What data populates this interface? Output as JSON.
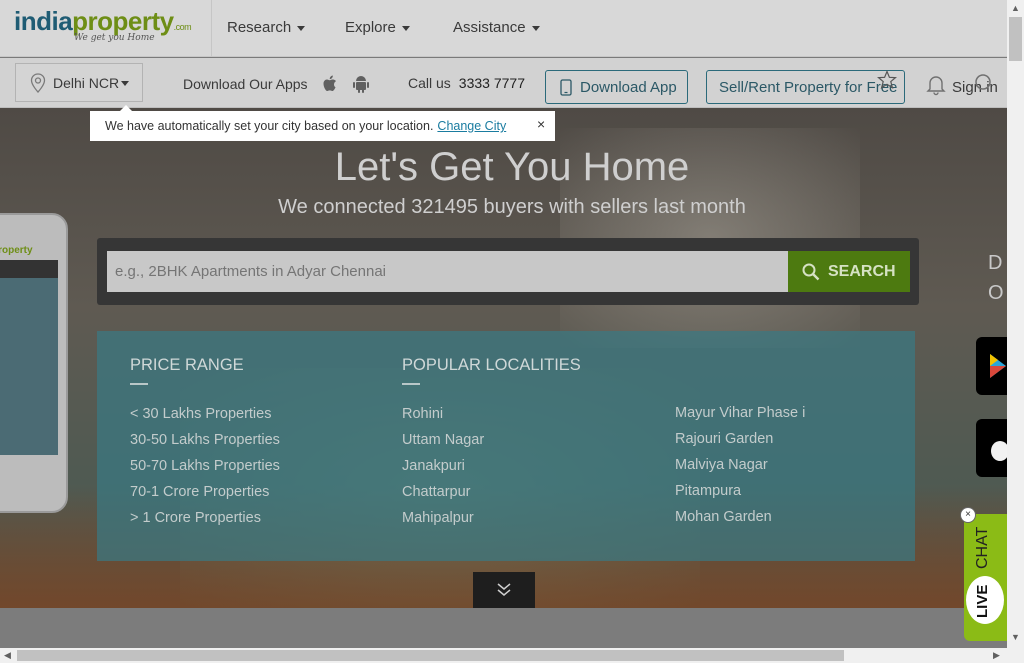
{
  "header": {
    "logo": {
      "part1": "india",
      "part2": "property",
      "suffix": ".com",
      "tagline": "We get you Home"
    },
    "nav": [
      {
        "label": "Research"
      },
      {
        "label": "Explore"
      },
      {
        "label": "Assistance"
      }
    ]
  },
  "subbar": {
    "city": "Delhi NCR",
    "apps_label": "Download Our Apps",
    "call_label": "Call us",
    "phone": "3333 7777",
    "download_app_label": "Download App",
    "sell_rent_label": "Sell/Rent Property for Free",
    "signin_label": "Sign in"
  },
  "city_tooltip": {
    "message": "We have automatically set your city based on your location.",
    "link": "Change City",
    "close": "×"
  },
  "hero": {
    "headline": "Let's Get You Home",
    "subline": "We connected 321495 buyers with sellers last month",
    "search_placeholder": "e.g., 2BHK Apartments in Adyar Chennai",
    "search_button": "SEARCH"
  },
  "quick_links": {
    "price_heading": "PRICE RANGE",
    "price_items": [
      "< 30 Lakhs Properties",
      "30-50 Lakhs Properties",
      "50-70 Lakhs Properties",
      "70-1 Crore Properties",
      "> 1 Crore Properties"
    ],
    "localities_heading": "POPULAR LOCALITIES",
    "localities_col1": [
      "Rohini",
      "Uttam Nagar",
      "Janakpuri",
      "Chattarpur",
      "Mahipalpur"
    ],
    "localities_col2": [
      "Mayur Vihar Phase i",
      "Rajouri Garden",
      "Malviya Nagar",
      "Pitampura",
      "Mohan Garden"
    ]
  },
  "side_promo": {
    "line1": "D",
    "line2": "O"
  },
  "phone_mock": {
    "logo": "property"
  },
  "live_chat": {
    "chat": "CHAT",
    "live": "LIVE",
    "close": "×"
  },
  "colors": {
    "brand_blue": "#1f5c74",
    "brand_green": "#6e8e16",
    "search_button": "#4d7a10",
    "quick_panel": "#3a7882",
    "live_chat": "#8bbb16"
  }
}
